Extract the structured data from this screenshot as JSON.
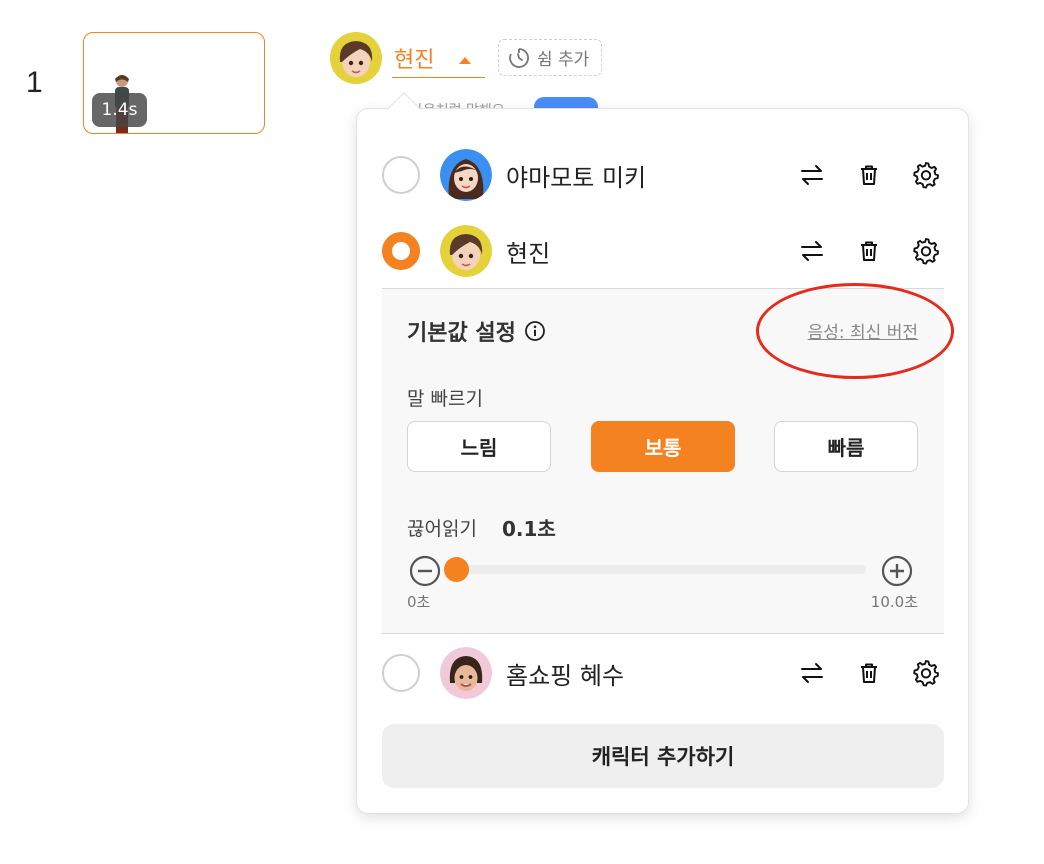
{
  "scene": {
    "number": "1",
    "duration": "1.4s"
  },
  "selector": {
    "character_name": "현진",
    "add_pause_label": "쉼 추가",
    "behind_text": "다음처럼 말해요"
  },
  "characters": [
    {
      "name": "야마모토 미키",
      "selected": false,
      "avatar_color": "#3b8ff0",
      "avatar_icon": "avatar-woman-long-hair"
    },
    {
      "name": "현진",
      "selected": true,
      "avatar_color": "#e5d23b",
      "avatar_icon": "avatar-woman-short-hair"
    },
    {
      "name": "홈쇼핑 혜수",
      "selected": false,
      "avatar_color": "#f2c9d8",
      "avatar_icon": "avatar-woman-bob-hair"
    }
  ],
  "row_action_icons": [
    "swap-arrows-icon",
    "trash-icon",
    "gear-icon"
  ],
  "settings": {
    "title": "기본값 설정",
    "info_icon": "info-circle-icon",
    "voice_version": "음성: 최신 버전",
    "speed_label": "말 빠르기",
    "speed_options": [
      "느림",
      "보통",
      "빠름"
    ],
    "speed_selected": "보통",
    "pause_label": "끊어읽기",
    "pause_value": "0.1초",
    "pause_fraction": 0.01,
    "slider_min": "0초",
    "slider_max": "10.0초"
  },
  "add_character_label": "캐릭터 추가하기",
  "colors": {
    "accent": "#f58220",
    "highlight": "#e52b1c"
  }
}
